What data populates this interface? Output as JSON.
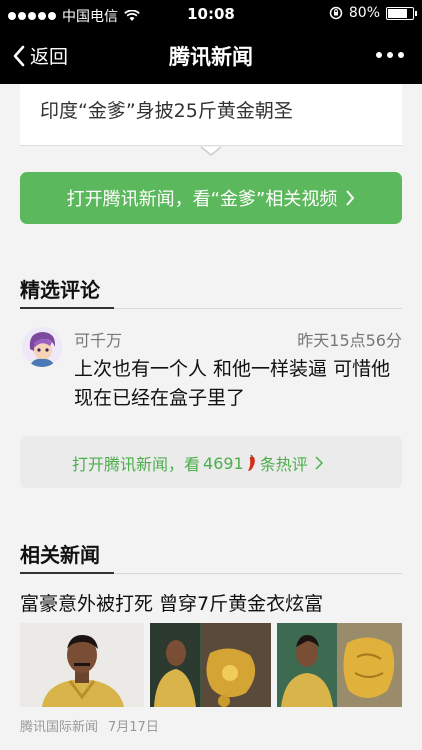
{
  "status_bar": {
    "carrier": "中国电信",
    "time": "10:08",
    "battery": "80%",
    "battery_level": 0.8
  },
  "nav": {
    "back_label": "返回",
    "title": "腾讯新闻"
  },
  "top_card": {
    "headline": "印度“金爹”身披25斤黄金朝圣"
  },
  "open_button": {
    "label": "打开腾讯新闻，看“金爹”相关视频"
  },
  "featured_comments": {
    "title": "精选评论",
    "comment": {
      "user": "可千万",
      "time": "昨天15点56分",
      "text": "上次也有一个人 和他一样装逼 可惜他现在已经在盒子里了"
    },
    "hot_bar": {
      "prefix": "打开腾讯新闻，看",
      "count": "4691",
      "suffix": "条热评"
    }
  },
  "related_news": {
    "title": "相关新闻",
    "item": {
      "headline": "富豪意外被打死 曾穿7斤黄金衣炫富",
      "source": "腾讯国际新闻",
      "date": "7月17日"
    }
  },
  "colors": {
    "accent_green": "#5cb85c",
    "nav_black": "#000000"
  }
}
